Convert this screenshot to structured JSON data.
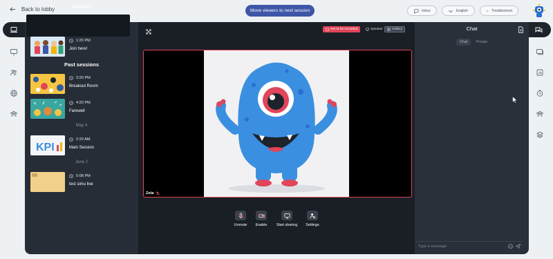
{
  "topbar": {
    "back_label": "Back to lobby",
    "move_viewers_label": "Move viewers to next session",
    "inbox_label": "Inbox",
    "language_label": "English",
    "troubleshoot_label": "Troubleshoot"
  },
  "activities": {
    "title": "Activities",
    "current": {
      "time": "1:20 PM",
      "name": "Join here!"
    },
    "past_title": "Past sessions",
    "sessions": [
      {
        "time": "3:20 PM",
        "name": "Breakout Room"
      },
      {
        "time": "4:20 PM",
        "name": "Farewell"
      },
      {
        "date_separator": "May 4"
      },
      {
        "time": "2:20 AM",
        "name": "Main Session"
      },
      {
        "date_separator": "June 2"
      },
      {
        "time": "5:08 PM",
        "name": "test simu live"
      }
    ],
    "kpi_text": "KPI"
  },
  "stage": {
    "recording_label": "Set to be recorded",
    "speaker_label": "Speaker",
    "gallery_label": "Gallery",
    "participant_name": "Zeta"
  },
  "controls": {
    "unmute_label": "Unmute",
    "enable_label": "Enable",
    "share_label": "Start sharing",
    "settings_label": "Settings"
  },
  "chat": {
    "title": "Chat",
    "tab_chat": "Chat",
    "tab_private": "Private",
    "input_placeholder": "Type a message"
  },
  "colors": {
    "accent": "#3d56a8",
    "record": "#e0455a",
    "dark_bg": "#1d232b",
    "monster": "#3b8fe0"
  }
}
